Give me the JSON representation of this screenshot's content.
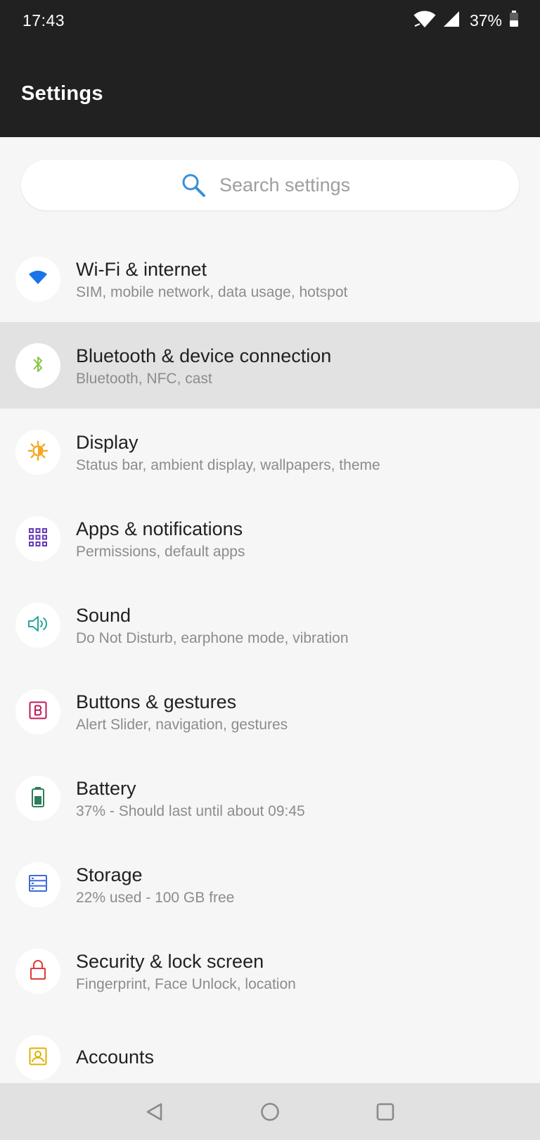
{
  "status_bar": {
    "time": "17:43",
    "battery_percent": "37%",
    "icons": [
      "wifi-icon",
      "signal-icon",
      "battery-icon"
    ]
  },
  "header": {
    "title": "Settings"
  },
  "search": {
    "placeholder": "Search settings",
    "icon": "search-icon"
  },
  "settings": {
    "items": [
      {
        "id": "wifi",
        "title": "Wi-Fi & internet",
        "subtitle": "SIM, mobile network, data usage, hotspot",
        "icon": "wifi-icon",
        "color": "#1a73e8"
      },
      {
        "id": "bluetooth",
        "title": "Bluetooth & device connection",
        "subtitle": "Bluetooth, NFC, cast",
        "icon": "bluetooth-icon",
        "color": "#8bc34a"
      },
      {
        "id": "display",
        "title": "Display",
        "subtitle": "Status bar, ambient display, wallpapers, theme",
        "icon": "brightness-icon",
        "color": "#f5a623"
      },
      {
        "id": "apps",
        "title": "Apps & notifications",
        "subtitle": "Permissions, default apps",
        "icon": "apps-grid-icon",
        "color": "#673ab7"
      },
      {
        "id": "sound",
        "title": "Sound",
        "subtitle": "Do Not Disturb, earphone mode, vibration",
        "icon": "speaker-icon",
        "color": "#26a69a"
      },
      {
        "id": "buttons",
        "title": "Buttons & gestures",
        "subtitle": "Alert Slider, navigation, gestures",
        "icon": "button-b-icon",
        "color": "#c2185b"
      },
      {
        "id": "battery",
        "title": "Battery",
        "subtitle": "37% - Should last until about 09:45",
        "icon": "battery-icon",
        "color": "#2e7d5b"
      },
      {
        "id": "storage",
        "title": "Storage",
        "subtitle": "22% used - 100 GB free",
        "icon": "storage-icon",
        "color": "#3f6ad8"
      },
      {
        "id": "security",
        "title": "Security & lock screen",
        "subtitle": "Fingerprint, Face Unlock, location",
        "icon": "lock-icon",
        "color": "#e53935"
      },
      {
        "id": "accounts",
        "title": "Accounts",
        "subtitle": "",
        "icon": "account-icon",
        "color": "#e0b000"
      }
    ]
  },
  "nav_bar": {
    "buttons": [
      "back-icon",
      "home-icon",
      "recents-icon"
    ]
  },
  "colors": {
    "header_bg": "#212121",
    "page_bg": "#f6f6f6",
    "highlight_bg": "#e2e2e2",
    "search_icon": "#3a8fd6"
  }
}
